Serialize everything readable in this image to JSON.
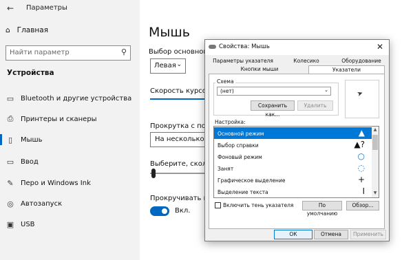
{
  "app": {
    "title": "Параметры"
  },
  "sidebar": {
    "home": "Главная",
    "search_placeholder": "Найти параметр",
    "section": "Устройства",
    "items": [
      {
        "label": "Bluetooth и другие устройства",
        "icon": "bluetooth-icon"
      },
      {
        "label": "Принтеры и сканеры",
        "icon": "printer-icon"
      },
      {
        "label": "Мышь",
        "icon": "mouse-icon"
      },
      {
        "label": "Ввод",
        "icon": "keyboard-icon"
      },
      {
        "label": "Перо и Windows Ink",
        "icon": "pen-icon"
      },
      {
        "label": "Автозапуск",
        "icon": "autoplay-icon"
      },
      {
        "label": "USB",
        "icon": "usb-icon"
      }
    ]
  },
  "page": {
    "title": "Мышь",
    "primary_button_label": "Выбор основной кно",
    "primary_button_value": "Левая",
    "cursor_speed_label": "Скорость курсора",
    "scroll_label": "Прокрутка с помощ",
    "scroll_value": "На несколько стро",
    "lines_label": "Выберите, сколько с",
    "inactive_scroll_label": "Прокручивать неак",
    "inactive_scroll_state": "Вкл."
  },
  "dialog": {
    "title": "Свойства: Мышь",
    "tabs_row1": [
      "Параметры указателя",
      "Колесико",
      "Оборудование"
    ],
    "tabs_row2": [
      "Кнопки мыши",
      "Указатели"
    ],
    "active_tab": "Указатели",
    "scheme_group": "Схема",
    "scheme_value": "(нет)",
    "save_as": "Сохранить как...",
    "delete": "Удалить",
    "customize_label": "Настройка:",
    "cursors": [
      {
        "label": "Основной режим",
        "glyph": "▲"
      },
      {
        "label": "Выбор справки",
        "glyph": "▲?"
      },
      {
        "label": "Фоновый режим",
        "glyph": "○"
      },
      {
        "label": "Занят",
        "glyph": "◌"
      },
      {
        "label": "Графическое выделение",
        "glyph": "+"
      },
      {
        "label": "Выделение текста",
        "glyph": "I"
      }
    ],
    "shadow_checkbox": "Включить тень указателя",
    "default_btn": "По умолчанию",
    "browse_btn": "Обзор...",
    "ok": "ОК",
    "cancel": "Отмена",
    "apply": "Применить"
  },
  "colors": {
    "accent": "#0067c0",
    "selection": "#0078d7"
  }
}
